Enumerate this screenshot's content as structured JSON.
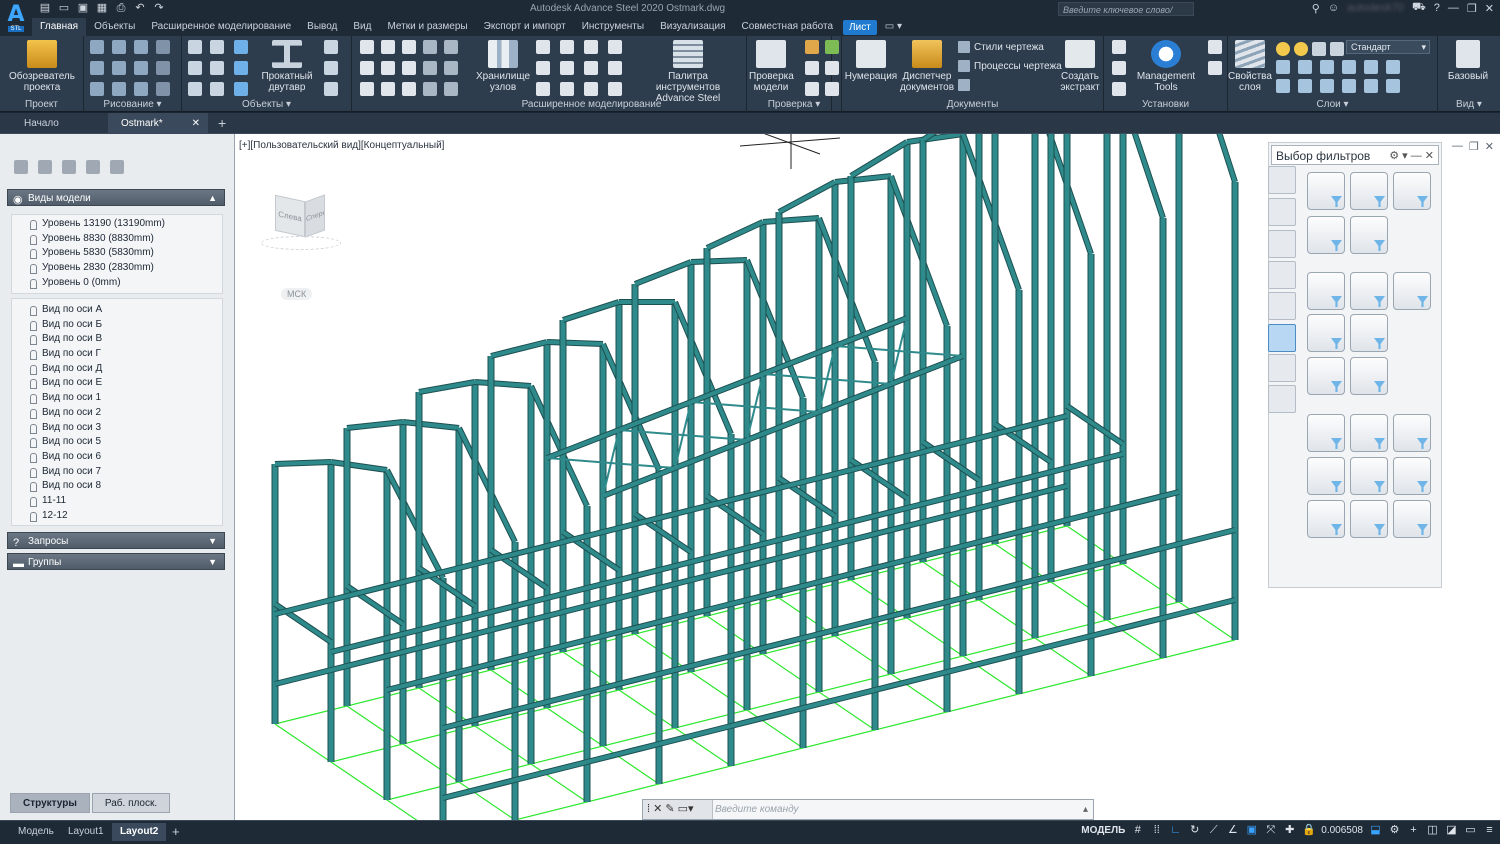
{
  "app": {
    "title_text": "Autodesk Advance Steel 2020   Ostmark.dwg",
    "search_placeholder": "Введите ключевое слово/фразу",
    "account_text": "autodesk70"
  },
  "menu": {
    "tabs": [
      "Главная",
      "Объекты",
      "Расширенное моделирование",
      "Вывод",
      "Вид",
      "Метки и размеры",
      "Экспорт и импорт",
      "Инструменты",
      "Визуализация",
      "Совместная работа",
      "Лист"
    ],
    "extra": "▭ ▾"
  },
  "ribbon": {
    "project": {
      "btn": "Обозреватель проекта",
      "label": "Проект"
    },
    "draw": {
      "label": "Рисование ▾"
    },
    "objects": {
      "btn": "Прокатный двутавр",
      "label": "Объекты ▾"
    },
    "adv": {
      "btn1": "Хранилище узлов",
      "btn2": "Палитра инструментов Advance Steel",
      "label": "Расширенное моделирование"
    },
    "check": {
      "btn": "Проверка модели",
      "label": "Проверка ▾"
    },
    "docs": {
      "btn1": "Нумерация",
      "btn2": "Диспетчер документов",
      "row1": "Стили чертежа",
      "row2": "Процессы чертежа",
      "btn3": "Создать экстракт",
      "label": "Документы"
    },
    "settings": {
      "btn": "Management Tools",
      "label": "Установки"
    },
    "layers": {
      "btn": "Свойства слоя",
      "combo": "Стандарт",
      "label": "Слои ▾"
    },
    "view": {
      "btn": "Базовый",
      "label": "Вид ▾"
    }
  },
  "doctabs": [
    {
      "label": "Начало"
    },
    {
      "label": "Ostmark*"
    }
  ],
  "left": {
    "section_views": "Виды модели",
    "levels": [
      "Уровень 13190 (13190mm)",
      "Уровень 8830 (8830mm)",
      "Уровень 5830 (5830mm)",
      "Уровень 2830 (2830mm)",
      "Уровень 0 (0mm)"
    ],
    "axes": [
      "Вид по оси А",
      "Вид по оси Б",
      "Вид по оси В",
      "Вид по оси Г",
      "Вид по оси Д",
      "Вид по оси Е",
      "Вид по оси 1",
      "Вид по оси 2",
      "Вид по оси 3",
      "Вид по оси 5",
      "Вид по оси 6",
      "Вид по оси 7",
      "Вид по оси 8",
      "11-11",
      "12-12"
    ],
    "section_queries": "Запросы",
    "section_groups": "Группы",
    "tab_structures": "Структуры",
    "tab_planes": "Раб. плоск."
  },
  "viewport": {
    "label": "[+][Пользовательский вид][Концептуальный]",
    "cube_left": "Слева",
    "cube_front": "Спереди",
    "ucs": "МСК"
  },
  "filter": {
    "title": "Выбор фильтров"
  },
  "cmd": {
    "placeholder": "Введите команду"
  },
  "status": {
    "tabs": [
      "Модель",
      "Layout1",
      "Layout2"
    ],
    "mode": "МОДЕЛЬ",
    "scale": "0.006508"
  },
  "colors": {
    "accent": "#1f7ad0",
    "steel": "#2f8b8b",
    "grid": "#2ee62e"
  }
}
